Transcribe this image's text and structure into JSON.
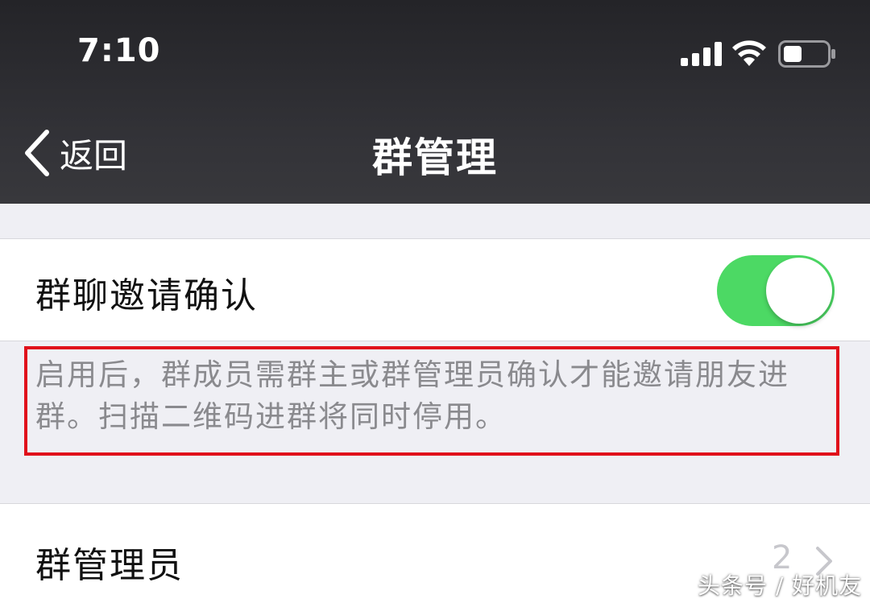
{
  "status_bar": {
    "time": "7:10",
    "icons": [
      "signal-icon",
      "wifi-icon",
      "battery-icon"
    ]
  },
  "nav": {
    "back_label": "返回",
    "title": "群管理"
  },
  "settings": {
    "invite_confirm": {
      "label": "群聊邀请确认",
      "enabled": true,
      "description": "启用后，群成员需群主或群管理员确认才能邀请朋友进群。扫描二维码进群将同时停用。"
    },
    "admins": {
      "label": "群管理员",
      "count": "2"
    }
  },
  "colors": {
    "toggle_on": "#4cd964",
    "highlight_border": "#e0101a",
    "nav_background": "#333338"
  },
  "watermark": "头条号 / 好机友"
}
